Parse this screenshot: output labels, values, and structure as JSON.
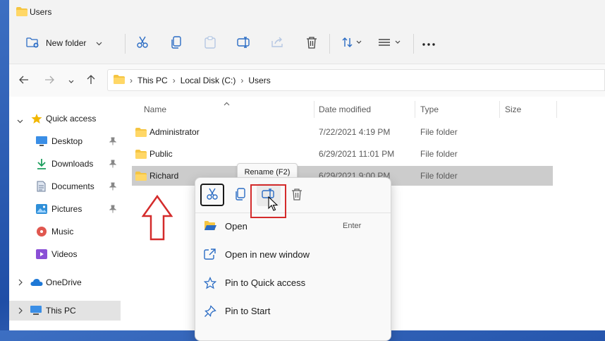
{
  "window": {
    "title": "Users"
  },
  "toolbar": {
    "new_folder_label": "New folder",
    "icons": [
      "cut-icon",
      "copy-icon",
      "paste-icon",
      "rename-icon",
      "share-icon",
      "delete-icon",
      "sort-icon",
      "view-icon",
      "more-icon"
    ]
  },
  "address": {
    "crumbs": [
      "This PC",
      "Local Disk (C:)",
      "Users"
    ],
    "separator": "›"
  },
  "sidebar": {
    "items": [
      {
        "label": "Quick access",
        "icon": "star-icon",
        "color": "#f2b700"
      },
      {
        "label": "Desktop",
        "icon": "desktop-icon",
        "color": "#3a8ee6",
        "pinned": true
      },
      {
        "label": "Downloads",
        "icon": "download-icon",
        "color": "#1d9e5e",
        "pinned": true
      },
      {
        "label": "Documents",
        "icon": "document-icon",
        "color": "#6b7d99",
        "pinned": true
      },
      {
        "label": "Pictures",
        "icon": "picture-icon",
        "color": "#2f8fd8",
        "pinned": true
      },
      {
        "label": "Music",
        "icon": "music-icon",
        "color": "#e0574f"
      },
      {
        "label": "Videos",
        "icon": "video-icon",
        "color": "#8a4fd6"
      },
      {
        "label": "OneDrive",
        "icon": "cloud-icon",
        "color": "#1e78d6"
      },
      {
        "label": "This PC",
        "icon": "computer-icon",
        "color": "#3a8ee6",
        "selected": true
      }
    ]
  },
  "list": {
    "columns": [
      "Name",
      "Date modified",
      "Type",
      "Size"
    ],
    "rows": [
      {
        "name": "Administrator",
        "date": "7/22/2021 4:19 PM",
        "type": "File folder"
      },
      {
        "name": "Public",
        "date": "6/29/2021 11:01 PM",
        "type": "File folder"
      },
      {
        "name": "Richard",
        "date": "6/29/2021 9:00 PM",
        "type": "File folder",
        "selected": true
      }
    ]
  },
  "tooltip": {
    "text": "Rename (F2)"
  },
  "context_menu": {
    "icons": [
      "cut-icon",
      "copy-icon",
      "rename-icon",
      "delete-icon"
    ],
    "items": [
      {
        "label": "Open",
        "shortcut": "Enter",
        "icon": "open-folder-icon"
      },
      {
        "label": "Open in new window",
        "icon": "open-new-window-icon"
      },
      {
        "label": "Pin to Quick access",
        "icon": "star-outline-icon"
      },
      {
        "label": "Pin to Start",
        "icon": "pin-icon"
      }
    ]
  },
  "colors": {
    "folder": "#f5c542",
    "selection": "#cccccc",
    "annotation": "#d42b2b"
  }
}
